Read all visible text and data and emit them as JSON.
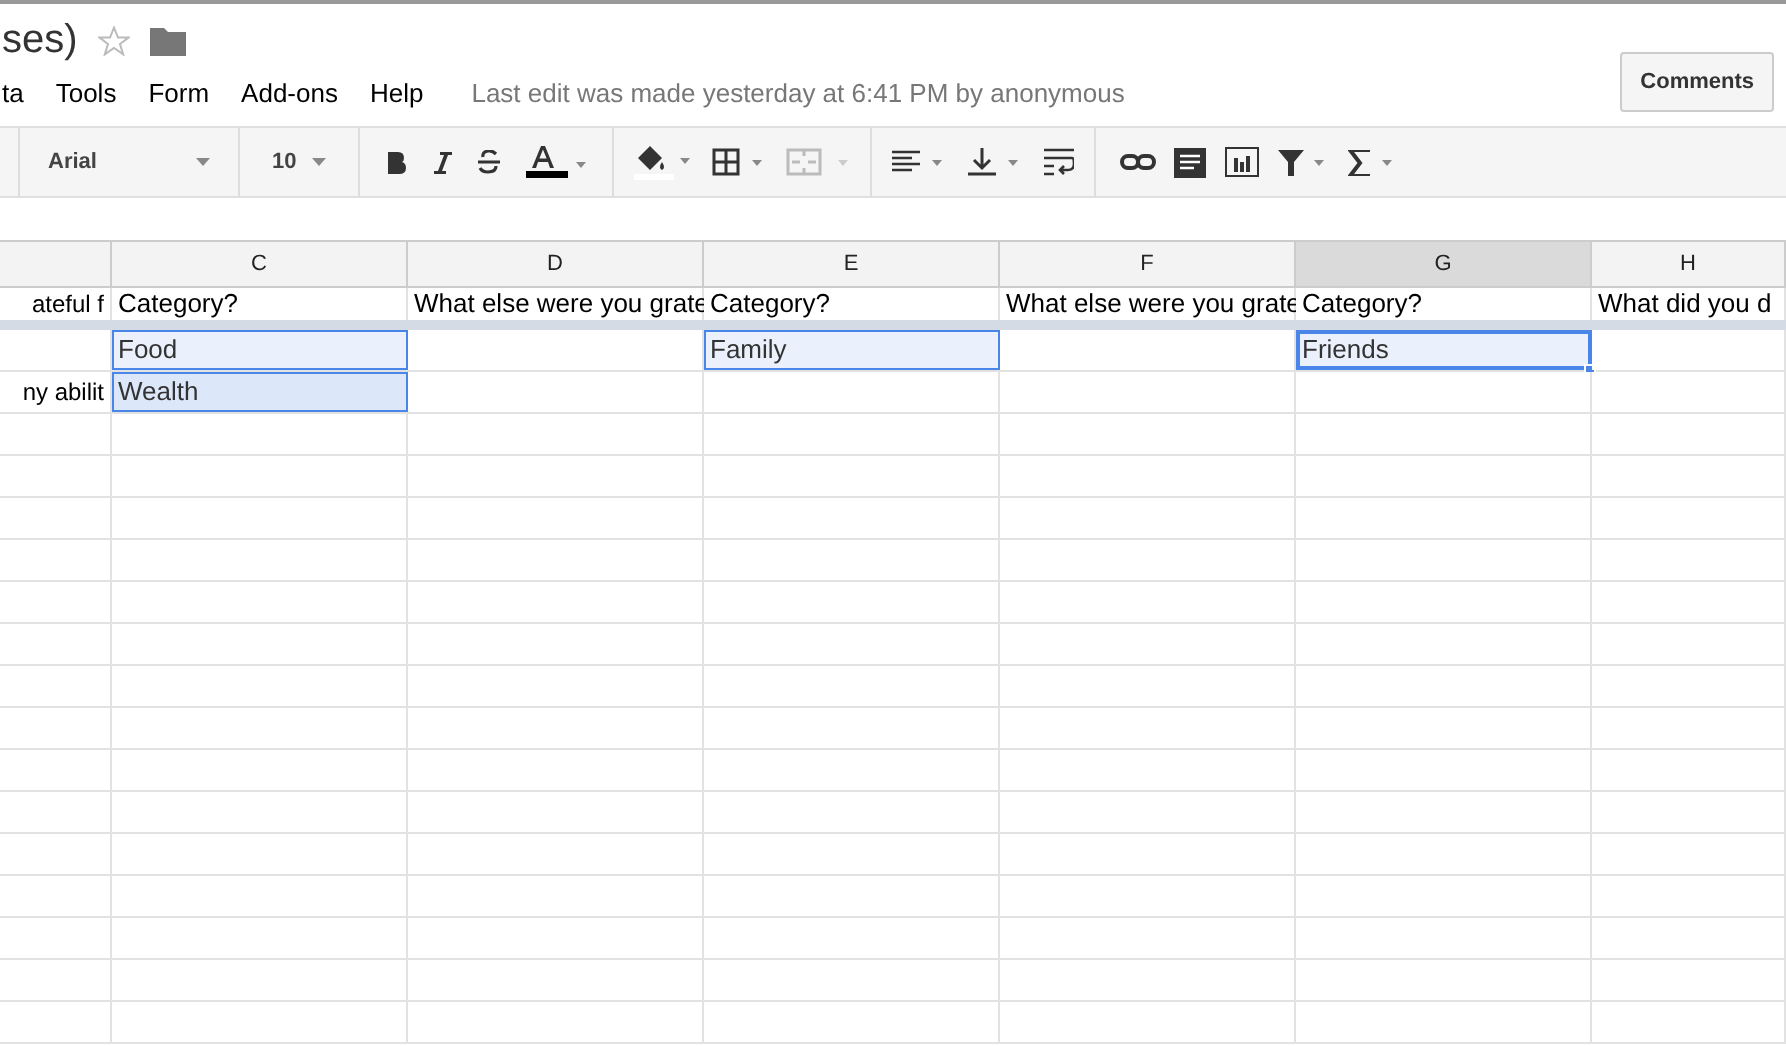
{
  "doc_title": "ses)",
  "menu": [
    "ta",
    "Tools",
    "Form",
    "Add-ons",
    "Help"
  ],
  "last_edit": "Last edit was made yesterday at 6:41 PM by anonymous",
  "comments_button": "Comments",
  "toolbar": {
    "font": "Arial",
    "font_size": "10"
  },
  "columns": [
    {
      "selected": false
    },
    {
      "label": "C",
      "selected": false
    },
    {
      "label": "D",
      "selected": false
    },
    {
      "label": "E",
      "selected": false
    },
    {
      "label": "F",
      "selected": false
    },
    {
      "label": "G",
      "selected": true
    },
    {
      "label": "H",
      "selected": false
    }
  ],
  "rows": [
    {
      "cells": [
        {
          "text": "ateful f",
          "selected": false
        },
        {
          "text": "Category?",
          "selected": false
        },
        {
          "text": "What else were you grate",
          "selected": false
        },
        {
          "text": "Category?",
          "selected": false
        },
        {
          "text": "What else were you grate",
          "selected": false
        },
        {
          "text": "Category?",
          "selected": false
        },
        {
          "text": "What did you d",
          "selected": false
        }
      ]
    },
    {
      "cells": [
        {
          "text": "",
          "selected": false
        },
        {
          "text": "Food",
          "selected": true
        },
        {
          "text": "",
          "selected": false
        },
        {
          "text": "Family",
          "selected": true
        },
        {
          "text": "",
          "selected": false
        },
        {
          "text": "Friends",
          "selected": true,
          "active": true
        },
        {
          "text": "",
          "selected": false
        }
      ]
    },
    {
      "cells": [
        {
          "text": "ny abilit",
          "selected": false
        },
        {
          "text": "Wealth",
          "selected": true
        },
        {
          "text": "",
          "selected": false
        },
        {
          "text": "",
          "selected": false
        },
        {
          "text": "",
          "selected": false
        },
        {
          "text": "",
          "selected": false
        },
        {
          "text": "",
          "selected": false
        }
      ]
    }
  ]
}
